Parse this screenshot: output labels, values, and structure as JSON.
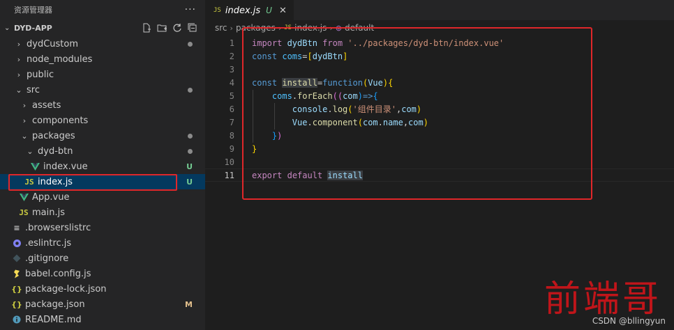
{
  "sidebar": {
    "title": "资源管理器",
    "more": "···",
    "project": "DYD-APP",
    "items": [
      {
        "label": "dydCustom",
        "twist": "›",
        "depth": 0,
        "deco": "dot"
      },
      {
        "label": "node_modules",
        "twist": "›",
        "depth": 0,
        "deco": ""
      },
      {
        "label": "public",
        "twist": "›",
        "depth": 0,
        "deco": ""
      },
      {
        "label": "src",
        "twist": "⌄",
        "depth": 0,
        "deco": "dot"
      },
      {
        "label": "assets",
        "twist": "›",
        "depth": 1,
        "deco": ""
      },
      {
        "label": "components",
        "twist": "›",
        "depth": 1,
        "deco": ""
      },
      {
        "label": "packages",
        "twist": "⌄",
        "depth": 1,
        "deco": "dot"
      },
      {
        "label": "dyd-btn",
        "twist": "⌄",
        "depth": 2,
        "deco": "dot"
      },
      {
        "label": "index.vue",
        "icon": "vue",
        "depth": 3,
        "deco": "U"
      },
      {
        "label": "index.js",
        "icon": "js",
        "depth": 2,
        "deco": "U",
        "selected": true
      },
      {
        "label": "App.vue",
        "icon": "vue",
        "depth": 1,
        "deco": ""
      },
      {
        "label": "main.js",
        "icon": "js",
        "depth": 1,
        "deco": ""
      },
      {
        "label": ".browserslistrc",
        "icon": "lines",
        "depth": 0,
        "deco": ""
      },
      {
        "label": ".eslintrc.js",
        "icon": "eslint",
        "depth": 0,
        "deco": ""
      },
      {
        "label": ".gitignore",
        "icon": "git",
        "depth": 0,
        "deco": ""
      },
      {
        "label": "babel.config.js",
        "icon": "babel",
        "depth": 0,
        "deco": ""
      },
      {
        "label": "package-lock.json",
        "icon": "json",
        "depth": 0,
        "deco": ""
      },
      {
        "label": "package.json",
        "icon": "json",
        "depth": 0,
        "deco": "M"
      },
      {
        "label": "README.md",
        "icon": "info",
        "depth": 0,
        "deco": ""
      }
    ]
  },
  "tab": {
    "icon": "JS",
    "name": "index.js",
    "status": "U",
    "close": "✕"
  },
  "breadcrumbs": [
    "src",
    "packages",
    "JS",
    "index.js",
    "default"
  ],
  "icons": {
    "js": "JS"
  },
  "code": {
    "lines": [
      "1",
      "2",
      "3",
      "4",
      "5",
      "6",
      "7",
      "8",
      "9",
      "10",
      "11"
    ],
    "l1": {
      "kw": "import",
      "name": " dydBtn ",
      "from": "from",
      "str": " '../packages/dyd-btn/index.vue'"
    },
    "l2": {
      "kw": "const",
      "name": " coms",
      "eq": "=",
      "open": "[",
      "val": "dydBtn",
      "close": "]"
    },
    "l4": {
      "kw": "const",
      "name": "install",
      "eq": "=",
      "fn": "function",
      "open": "(",
      "param": "Vue",
      "close": ")",
      "brace": "{"
    },
    "l5": {
      "obj": "coms",
      "dot": ".",
      "method": "forEach",
      "open": "((",
      "param": "com",
      "close": ")",
      "arrow": "=>",
      "brace": "{"
    },
    "l6": {
      "obj": "console",
      "dot": ".",
      "method": "log",
      "open": "(",
      "str": "'组件目录'",
      "comma": ",",
      "param": "com",
      "close": ")"
    },
    "l7": {
      "obj": "Vue",
      "dot": ".",
      "method": "component",
      "open": "(",
      "a": "com",
      "dot2": ".",
      "b": "name",
      "comma": ",",
      "c": "com",
      "close": ")"
    },
    "l8": {
      "brace": "}",
      "close": ")"
    },
    "l9": {
      "brace": "}"
    },
    "l11": {
      "kw": "export",
      "kw2": "default",
      "name": "install"
    }
  },
  "watermark": "前端哥",
  "csdn": "CSDN @bllingyun"
}
